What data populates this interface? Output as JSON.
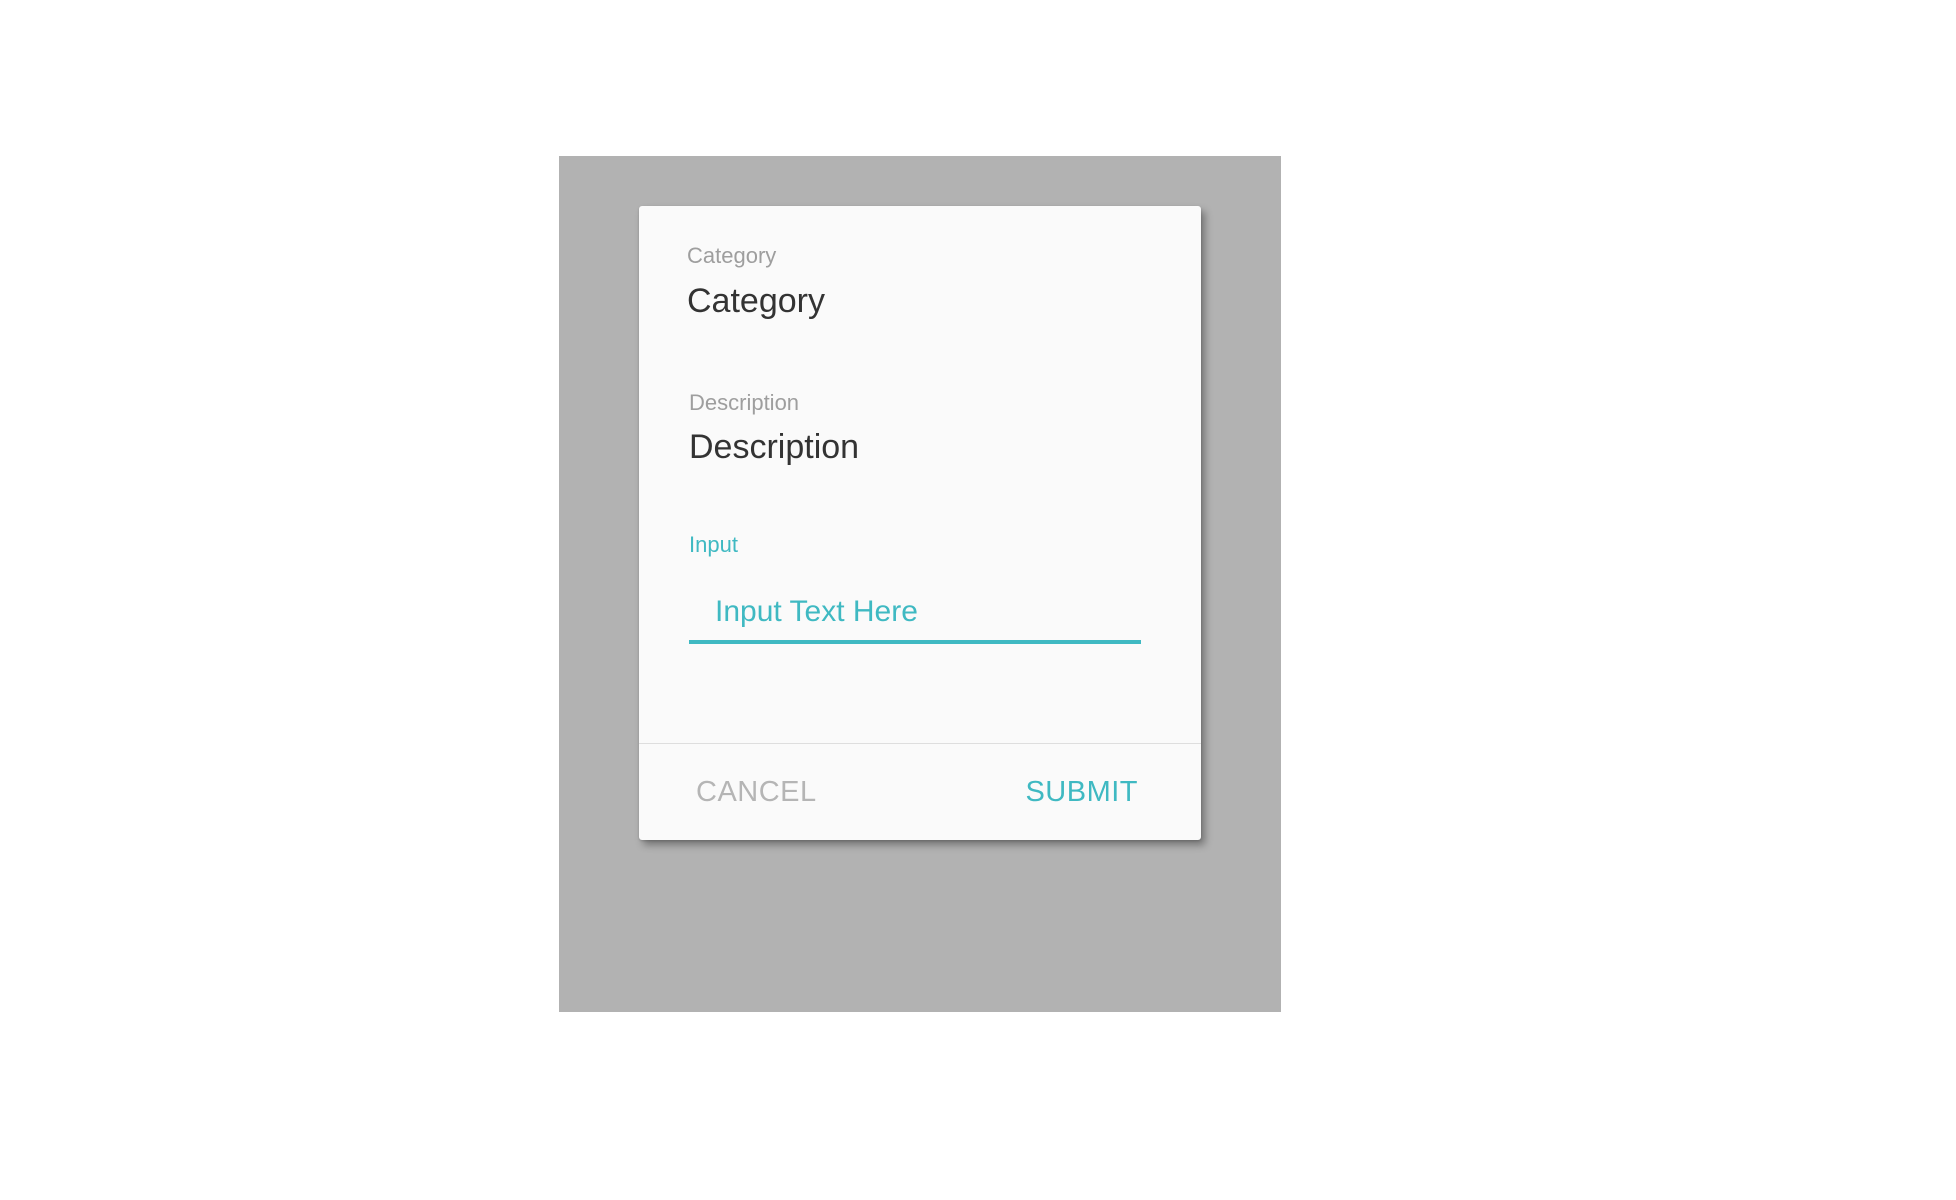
{
  "dialog": {
    "category": {
      "label": "Category",
      "value": "Category"
    },
    "description": {
      "label": "Description",
      "value": "Description"
    },
    "input": {
      "label": "Input",
      "placeholder": "Input Text Here",
      "value": ""
    },
    "actions": {
      "cancel_label": "CANCEL",
      "submit_label": "SUBMIT"
    }
  },
  "colors": {
    "accent": "#3fb9c2",
    "overlay": "#b2b2b2",
    "dialog_background": "#fafafa",
    "label": "#9e9e9e",
    "value_text": "#333333",
    "cancel_text": "#b5b5b5"
  }
}
